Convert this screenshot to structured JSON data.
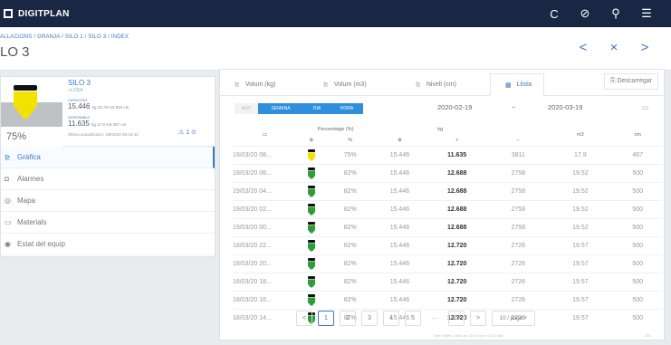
{
  "app": {
    "title": "DIGITPLAN"
  },
  "topbar": {
    "icons": [
      "refresh-icon",
      "compass-icon",
      "search-icon",
      "menu-icon"
    ],
    "glyphs": [
      "C",
      "⊘",
      "⚲",
      "☰"
    ]
  },
  "breadcrumb": "ALLACIONS / GRANJA / SILO 1 / SILO 3 / INDEX",
  "page_title": "LO 3",
  "nav": {
    "prev": "<",
    "close": "×",
    "next": ">"
  },
  "silo": {
    "name": "SILO 3",
    "subtitle": "+LODA",
    "capacity_label": "CAPACITAT",
    "capacity_value": "15.446",
    "capacity_details": "kg 33.78 m3 810 cm",
    "available_label": "DISPONIBLE",
    "available_value": "11.635",
    "available_details": "kg 17.6 m3 467 cm",
    "percent": "75%",
    "last_reading": "Última actualització: 19/03/20 08:18:43",
    "alerts": "⚠ 1 ⊙",
    "fill_color": "#f2e200"
  },
  "menu": [
    {
      "label": "Gràfica",
      "icon": "chart-icon",
      "glyph": "⊵",
      "active": true
    },
    {
      "label": "Alarmes",
      "icon": "alarm-icon",
      "glyph": "◘",
      "active": false
    },
    {
      "label": "Mapa",
      "icon": "map-icon",
      "glyph": "◎",
      "active": false
    },
    {
      "label": "Materials",
      "icon": "box-icon",
      "glyph": "▭",
      "active": false
    },
    {
      "label": "Estat del equip",
      "icon": "status-icon",
      "glyph": "◉",
      "active": false
    }
  ],
  "tabs": [
    {
      "label": "Volum (kg)",
      "icon": "chart-icon",
      "glyph": "⊵"
    },
    {
      "label": "Volum (m3)",
      "icon": "chart-icon",
      "glyph": "⊵"
    },
    {
      "label": "Nivell (cm)",
      "icon": "chart-icon",
      "glyph": "⊵"
    },
    {
      "label": "Llista",
      "icon": "list-icon",
      "glyph": "▦"
    }
  ],
  "download_label": "Descarregar",
  "period": [
    "ANY",
    "SEMANA",
    "DIA",
    "HORA"
  ],
  "date_from": "2020-02-19",
  "date_sep": "~",
  "date_to": "2020-03-19",
  "table": {
    "group_headers": [
      "Percentatge (%)",
      "kg"
    ],
    "sub_headers": [
      "⊕",
      "%",
      "⊕",
      "+",
      "−",
      "m3",
      "cm"
    ],
    "rows": [
      [
        "19/03/20 08...",
        "75%",
        "15.446",
        "11.635",
        "3811",
        "17.9",
        "467"
      ],
      [
        "19/03/20 06...",
        "82%",
        "15.446",
        "12.688",
        "2758",
        "19.52",
        "500"
      ],
      [
        "19/03/20 04...",
        "82%",
        "15.446",
        "12.688",
        "2758",
        "19.52",
        "500"
      ],
      [
        "19/03/20 02...",
        "82%",
        "15.446",
        "12.688",
        "2758",
        "19.52",
        "500"
      ],
      [
        "19/03/20 00...",
        "82%",
        "15.446",
        "12.688",
        "2758",
        "19.52",
        "500"
      ],
      [
        "18/03/20 22...",
        "82%",
        "15.446",
        "12.720",
        "2726",
        "19.57",
        "500"
      ],
      [
        "18/03/20 20...",
        "82%",
        "15.446",
        "12.720",
        "2726",
        "19.57",
        "500"
      ],
      [
        "18/03/20 18...",
        "82%",
        "15.446",
        "12.720",
        "2726",
        "19.57",
        "500"
      ],
      [
        "18/03/20 16...",
        "82%",
        "15.446",
        "12.720",
        "2726",
        "19.57",
        "500"
      ],
      [
        "18/03/20 14...",
        "82%",
        "15.446",
        "12.720",
        "2726",
        "19.57",
        "500"
      ]
    ],
    "bucket_colors": [
      "#f2e200",
      "#2e9c3a",
      "#2e9c3a",
      "#2e9c3a",
      "#2e9c3a",
      "#2e9c3a",
      "#2e9c3a",
      "#2e9c3a",
      "#2e9c3a",
      "#2e9c3a"
    ]
  },
  "pagination": {
    "prev": "<",
    "pages": [
      "1",
      "2",
      "3",
      "4",
      "5"
    ],
    "ellipsis": "···",
    "last": "29",
    "next": ">",
    "per_page": "10 / page ˅"
  },
  "footer": "Dem Gràfic: 1681 av 124.3 cd en 133.3 AB",
  "footer_right": "201"
}
